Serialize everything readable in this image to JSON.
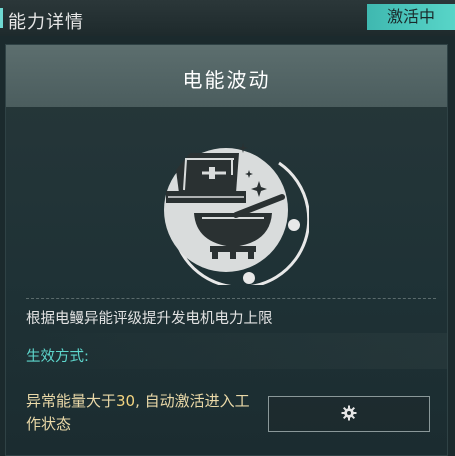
{
  "topbar": {
    "title": "能力详情",
    "status": "激活中"
  },
  "ability": {
    "name": "电能波动",
    "emblem_icon": "workbench-with-bowl-emblem-icon",
    "description": "根据电鳗异能评级提升发电机电力上限"
  },
  "effect": {
    "label": "生效方式:",
    "text_before": "异常能量大于",
    "threshold": "30",
    "text_after": ", 自动激活进入工作状态"
  },
  "controls": {
    "settings_icon": "gear-icon"
  },
  "colors": {
    "accent_teal": "#5ed7cd",
    "status_bg": "#49c6bc",
    "effect_text": "#ead9a8"
  }
}
